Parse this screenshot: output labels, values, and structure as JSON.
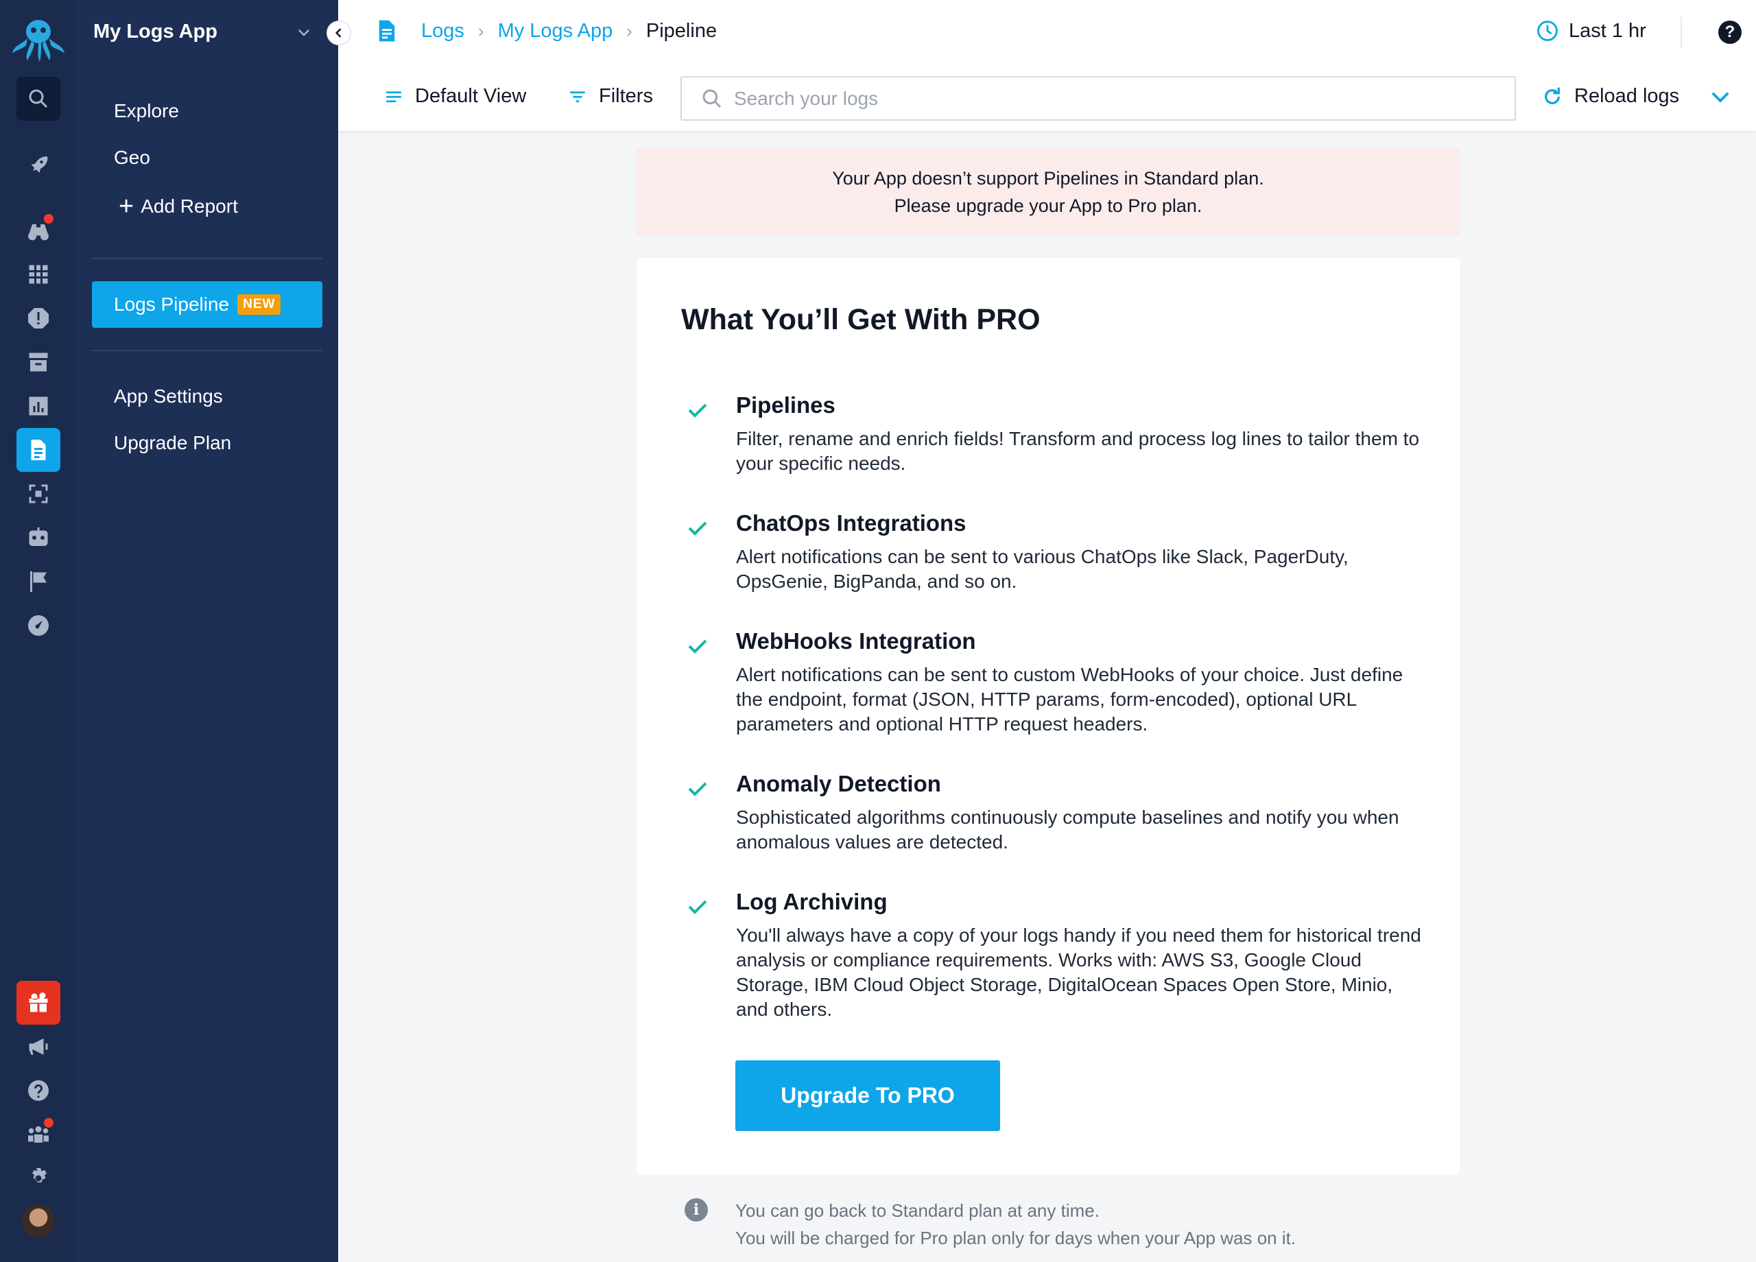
{
  "app": {
    "name": "My Logs App",
    "colors": {
      "accent": "#0ea5e9",
      "rail": "#1a2b4d",
      "nav": "#1d2f55",
      "alert_bg": "#fbeceb",
      "check": "#14b8a6",
      "gift": "#e5331f"
    }
  },
  "rail": {
    "icons": [
      "logo-octopus-icon",
      "search-icon",
      "rocket-icon",
      "binoculars-icon",
      "grid-icon",
      "alert-icon",
      "inbox-icon",
      "chart-icon",
      "logs-document-icon",
      "scan-icon",
      "robot-icon",
      "flag-icon",
      "dashboard-gauge-icon",
      "gift-icon",
      "megaphone-icon",
      "help-icon",
      "team-icon",
      "settings-gear-icon",
      "avatar"
    ]
  },
  "nav": {
    "items": [
      {
        "label": "Explore"
      },
      {
        "label": "Geo"
      }
    ],
    "add_report": "Add Report",
    "active_item": {
      "label": "Logs Pipeline",
      "badge": "NEW"
    },
    "bottom_items": [
      {
        "label": "App Settings"
      },
      {
        "label": "Upgrade Plan"
      }
    ]
  },
  "breadcrumb": {
    "items": [
      "Logs",
      "My Logs App",
      "Pipeline"
    ]
  },
  "header": {
    "time_range": "Last 1 hr",
    "help": "?"
  },
  "toolbar": {
    "default_view": "Default View",
    "filters": "Filters",
    "search_placeholder": "Search your logs",
    "search_value": "",
    "reload": "Reload logs"
  },
  "alert": {
    "line1": "Your App doesn’t support Pipelines in Standard plan.",
    "line2": "Please upgrade your App to Pro plan."
  },
  "pro": {
    "title": "What You’ll Get With PRO",
    "features": [
      {
        "title": "Pipelines",
        "description": "Filter, rename and enrich fields! Transform and process log lines to tailor them to your specific needs."
      },
      {
        "title": "ChatOps Integrations",
        "description": "Alert notifications can be sent to various ChatOps like Slack, PagerDuty, OpsGenie, BigPanda, and so on."
      },
      {
        "title": "WebHooks Integration",
        "description": "Alert notifications can be sent to custom WebHooks of your choice. Just define the endpoint, format (JSON, HTTP params, form-encoded), optional URL parameters and optional HTTP request headers."
      },
      {
        "title": "Anomaly Detection",
        "description": "Sophisticated algorithms continuously compute baselines and notify you when anomalous values are detected."
      },
      {
        "title": "Log Archiving",
        "description": "You'll always have a copy of your logs handy if you need them for historical trend analysis or compliance requirements. Works with: AWS S3, Google Cloud Storage, IBM Cloud Object Storage, DigitalOcean Spaces Open Store, Minio, and others."
      }
    ],
    "button": "Upgrade To PRO"
  },
  "footnote": {
    "line1": "You can go back to Standard plan at any time.",
    "line2": "You will be charged for Pro plan only for days when your App was on it."
  }
}
